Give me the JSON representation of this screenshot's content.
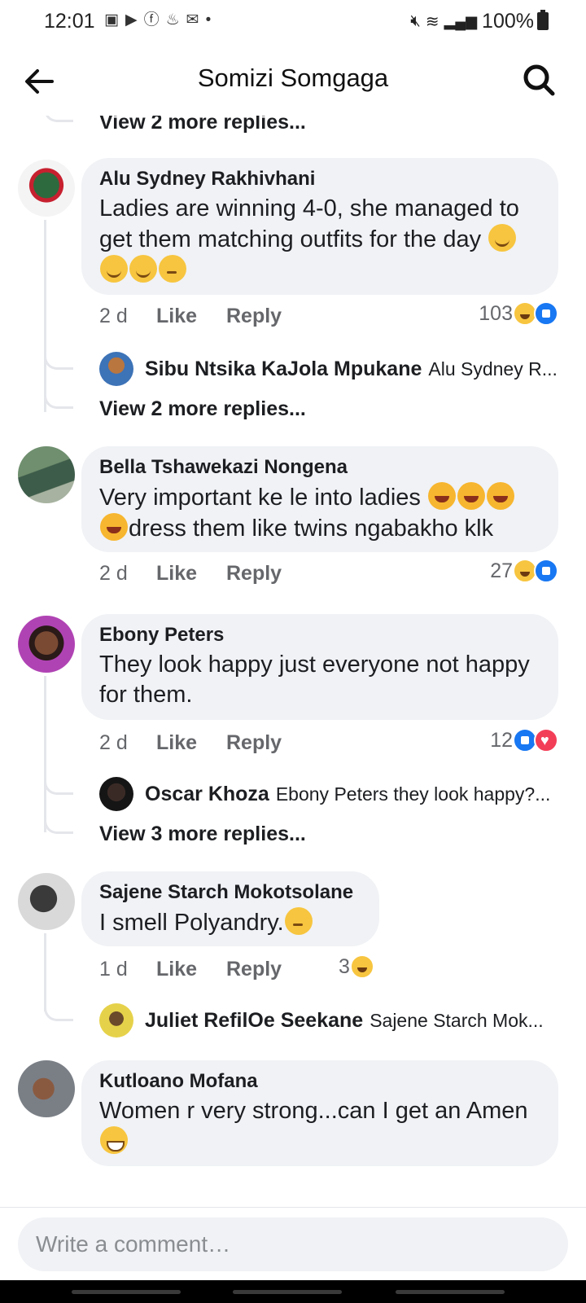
{
  "status_bar": {
    "time": "12:01",
    "battery": "100%",
    "notification_icons": [
      "youtube-icon",
      "facebook-icon",
      "gmail-icon"
    ]
  },
  "header": {
    "title": "Somizi Somgaga"
  },
  "comments": [
    {
      "view_more_top": "View 2 more replies..."
    },
    {
      "author": "Alu Sydney Rakhivhani",
      "text": "Ladies are winning 4-0, she managed to get them matching outfits for the day",
      "time": "2 d",
      "like_label": "Like",
      "reply_label": "Reply",
      "reaction_count": "103",
      "reactions": [
        "haha",
        "like"
      ],
      "reply_preview": {
        "author": "Sibu Ntsika KaJola Mpukane",
        "text": "Alu Sydney R..."
      },
      "view_more": "View 2 more replies..."
    },
    {
      "author": "Bella Tshawekazi Nongena",
      "text": "Very important ke le into ladies",
      "text2": "dress them like twins ngabakho klk",
      "time": "2 d",
      "like_label": "Like",
      "reply_label": "Reply",
      "reaction_count": "27",
      "reactions": [
        "haha",
        "like"
      ]
    },
    {
      "author": "Ebony Peters",
      "text": "They look happy just everyone not happy for them.",
      "time": "2 d",
      "like_label": "Like",
      "reply_label": "Reply",
      "reaction_count": "12",
      "reactions": [
        "like",
        "love"
      ],
      "reply_preview": {
        "author": "Oscar Khoza",
        "text": "Ebony Peters they look happy?..."
      },
      "view_more": "View 3 more replies..."
    },
    {
      "author": "Sajene Starch Mokotsolane",
      "text": "I smell Polyandry.",
      "time": "1 d",
      "like_label": "Like",
      "reply_label": "Reply",
      "reaction_count": "3",
      "reactions": [
        "haha"
      ],
      "reply_preview": {
        "author": "Juliet RefilOe Seekane",
        "text": "Sajene Starch Mok..."
      }
    },
    {
      "author": "Kutloano Mofana",
      "text": "Women r very strong...can I get an Amen"
    }
  ],
  "composer": {
    "placeholder": "Write a comment…"
  }
}
